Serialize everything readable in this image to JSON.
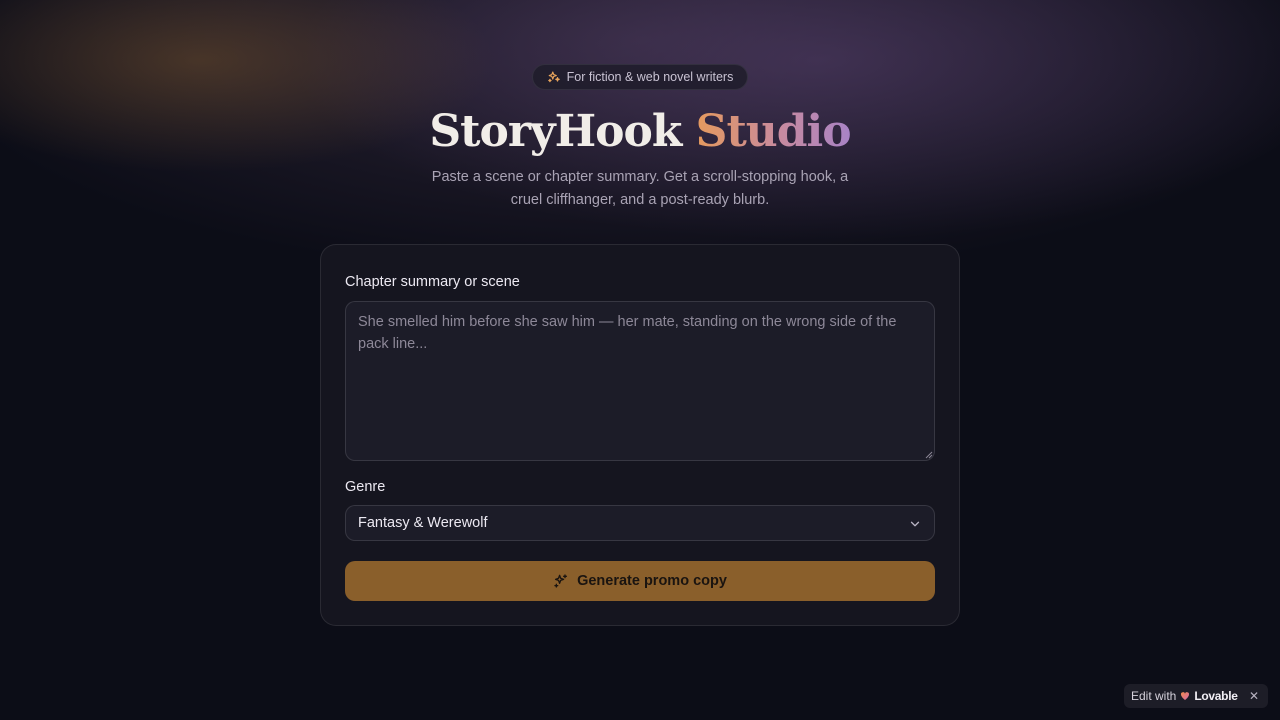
{
  "header": {
    "badge": "For fiction & web novel writers",
    "title_main": "StoryHook",
    "title_accent": "Studio",
    "subtitle": "Paste a scene or chapter summary. Get a scroll-stopping hook, a cruel cliffhanger, and a post-ready blurb."
  },
  "form": {
    "summary_label": "Chapter summary or scene",
    "summary_value": "",
    "summary_placeholder": "She smelled him before she saw him — her mate, standing on the wrong side of the pack line...",
    "genre_label": "Genre",
    "genre_selected": "Fantasy & Werewolf",
    "generate_label": "Generate promo copy"
  },
  "lovable_badge": {
    "prefix": "Edit with",
    "brand": "Lovable",
    "close": "✕"
  },
  "icons": {
    "badge": "sparkles-icon",
    "select": "chevron-down-icon",
    "button": "sparkles-icon",
    "brand": "lovable-heart-icon",
    "close": "close-icon"
  },
  "colors": {
    "background": "#0c0d17",
    "card": "#15151f",
    "accent_button": "#8a5f2b",
    "title_gradient_start": "#e59a5e",
    "title_gradient_end": "#a883c6"
  }
}
